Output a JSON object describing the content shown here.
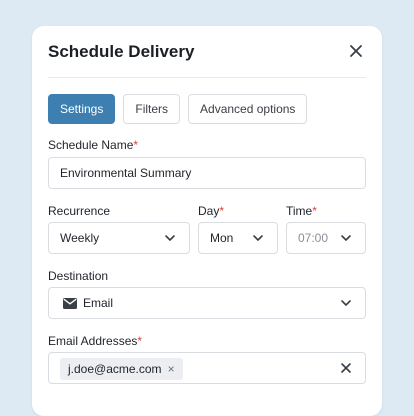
{
  "modal": {
    "title": "Schedule Delivery",
    "close_icon": "close-icon"
  },
  "tabs": [
    {
      "label": "Settings",
      "active": true
    },
    {
      "label": "Filters",
      "active": false
    },
    {
      "label": "Advanced options",
      "active": false
    }
  ],
  "form": {
    "schedule_name": {
      "label": "Schedule Name",
      "required_mark": "*",
      "value": "Environmental Summary"
    },
    "recurrence": {
      "label": "Recurrence",
      "value": "Weekly"
    },
    "day": {
      "label": "Day",
      "required_mark": "*",
      "value": "Mon"
    },
    "time": {
      "label": "Time",
      "required_mark": "*",
      "value": "07:00"
    },
    "destination": {
      "label": "Destination",
      "value": "Email",
      "icon": "mail-icon"
    },
    "email_addresses": {
      "label": "Email Addresses",
      "required_mark": "*",
      "chips": [
        "j.doe@acme.com"
      ],
      "chip_remove": "×"
    }
  },
  "colors": {
    "accent": "#3d7fb0",
    "required": "#d9433b",
    "background": "#deeaf3"
  }
}
